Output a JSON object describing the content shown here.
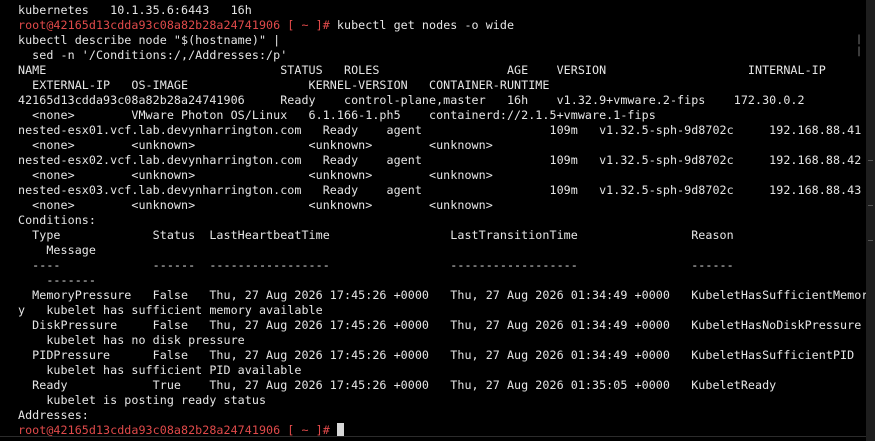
{
  "terminal": {
    "lines": [
      {
        "text": "kubernetes   10.1.35.6:6443   16h"
      },
      {
        "prompt": "root@42165d13cdda93c08a82b28a24741906 [ ~ ]#",
        "text": " kubectl get nodes -o wide"
      },
      {
        "text": "kubectl describe node \"$(hostname)\" |"
      },
      {
        "text": "  sed -n '/Conditions:/,/Addresses:/p'"
      },
      {
        "text": "NAME                                 STATUS   ROLES                  AGE    VERSION                    INTERNAL-IP"
      },
      {
        "text": "  EXTERNAL-IP   OS-IMAGE                 KERNEL-VERSION   CONTAINER-RUNTIME"
      },
      {
        "text": "42165d13cdda93c08a82b28a24741906     Ready    control-plane,master   16h    v1.32.9+vmware.2-fips    172.30.0.2"
      },
      {
        "text": "  <none>        VMware Photon OS/Linux   6.1.166-1.ph5    containerd://2.1.5+vmware.1-fips"
      },
      {
        "text": "nested-esx01.vcf.lab.devynharrington.com   Ready    agent                  109m   v1.32.5-sph-9d8702c     192.168.88.41"
      },
      {
        "text": "  <none>        <unknown>                <unknown>        <unknown>"
      },
      {
        "text": "nested-esx02.vcf.lab.devynharrington.com   Ready    agent                  109m   v1.32.5-sph-9d8702c     192.168.88.42"
      },
      {
        "text": "  <none>        <unknown>                <unknown>        <unknown>"
      },
      {
        "text": "nested-esx03.vcf.lab.devynharrington.com   Ready    agent                  109m   v1.32.5-sph-9d8702c     192.168.88.43"
      },
      {
        "text": "  <none>        <unknown>                <unknown>        <unknown>"
      },
      {
        "text": "Conditions:"
      },
      {
        "text": "  Type             Status  LastHeartbeatTime                 LastTransitionTime                Reason"
      },
      {
        "text": "    Message"
      },
      {
        "text": "  ----             ------  -----------------                 ------------------                ------"
      },
      {
        "text": "    -------"
      },
      {
        "text": "  MemoryPressure   False   Thu, 27 Aug 2026 17:45:26 +0000   Thu, 27 Aug 2026 01:34:49 +0000   KubeletHasSufficientMemor"
      },
      {
        "text": "y   kubelet has sufficient memory available"
      },
      {
        "text": "  DiskPressure     False   Thu, 27 Aug 2026 17:45:26 +0000   Thu, 27 Aug 2026 01:34:49 +0000   KubeletHasNoDiskPressure"
      },
      {
        "text": "    kubelet has no disk pressure"
      },
      {
        "text": "  PIDPressure      False   Thu, 27 Aug 2026 17:45:26 +0000   Thu, 27 Aug 2026 01:34:49 +0000   KubeletHasSufficientPID"
      },
      {
        "text": "    kubelet has sufficient PID available"
      },
      {
        "text": "  Ready            True    Thu, 27 Aug 2026 17:45:26 +0000   Thu, 27 Aug 2026 01:35:05 +0000   KubeletReady"
      },
      {
        "text": "    kubelet is posting ready status"
      },
      {
        "text": "Addresses:"
      },
      {
        "prompt": "root@42165d13cdda93c08a82b28a24741906 [ ~ ]#",
        "text": " ",
        "cursor": true
      }
    ]
  }
}
